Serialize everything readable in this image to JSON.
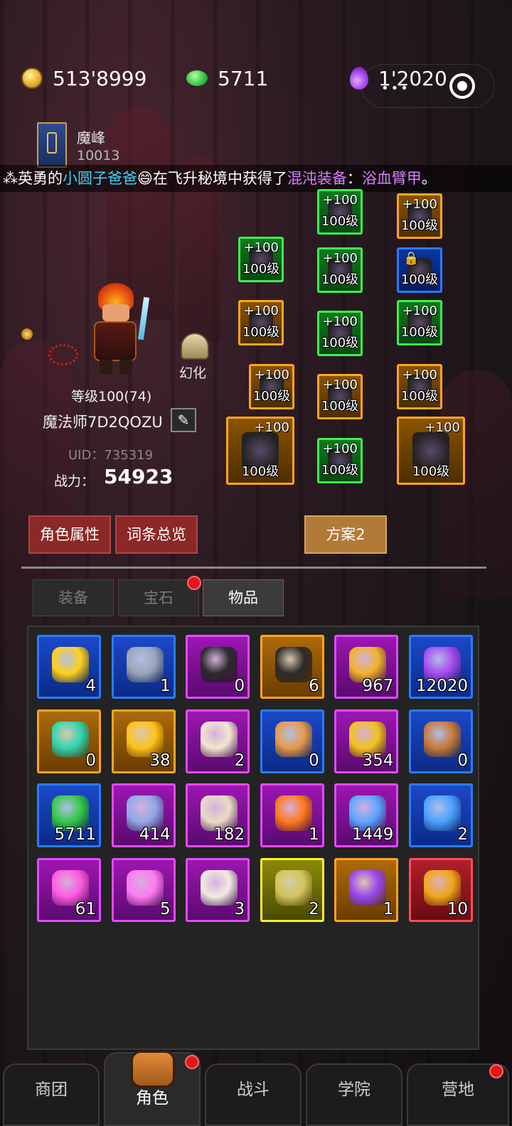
{
  "currency": {
    "gold": "513'8999",
    "emerald": "5711",
    "essence": "1'2020"
  },
  "guild": {
    "name": "魔峰",
    "id": "10013"
  },
  "banner": {
    "prefix": "英勇的",
    "player": "小圆子爸爸",
    "emoji": "😄",
    "middle": "在飞升秘境中获得了",
    "type": "混沌装备",
    "colon": "：",
    "item": "浴血臂甲",
    "end": "。"
  },
  "equipment": [
    {
      "plus": "+100",
      "level": "100级",
      "quality": "green",
      "icon": "wing-icon"
    },
    {
      "plus": "+100",
      "level": "100级",
      "quality": "orange",
      "icon": "necklace-icon"
    },
    {
      "plus": "+100",
      "level": "100级",
      "quality": "green",
      "icon": "purple-orb-icon"
    },
    {
      "plus": "+100",
      "level": "100级",
      "quality": "green",
      "icon": "armor-icon"
    },
    {
      "plus": "",
      "level": "100级",
      "quality": "blue",
      "icon": "cloak-icon",
      "locked": true
    },
    {
      "plus": "+100",
      "level": "100级",
      "quality": "orange",
      "icon": "gloves-icon"
    },
    {
      "plus": "+100",
      "level": "100级",
      "quality": "green",
      "icon": "belt-icon"
    },
    {
      "plus": "+100",
      "level": "100级",
      "quality": "green",
      "icon": "gauntlet-icon"
    },
    {
      "plus": "+100",
      "level": "100级",
      "quality": "orange",
      "icon": "bracer-icon"
    },
    {
      "plus": "+100",
      "level": "100级",
      "quality": "orange",
      "icon": "leggings-icon"
    },
    {
      "plus": "+100",
      "level": "100级",
      "quality": "orange",
      "icon": "ring-icon"
    },
    {
      "plus": "+100",
      "level": "100级",
      "quality": "orange",
      "icon": "dagger-icon"
    },
    {
      "plus": "+100",
      "level": "100级",
      "quality": "green",
      "icon": "boots-icon"
    },
    {
      "plus": "+100",
      "level": "100级",
      "quality": "orange",
      "icon": "shield-icon"
    }
  ],
  "character": {
    "transform_label": "幻化",
    "level": "等级100(74)",
    "name": "魔法师7D2QOZU",
    "uid": "UID：735319",
    "power_label": "战力：",
    "power": "54923"
  },
  "buttons": {
    "attributes": "角色属性",
    "entries": "词条总览",
    "plan": "方案2"
  },
  "tabs": [
    "装备",
    "宝石",
    "物品"
  ],
  "items": [
    {
      "count": "4",
      "rarity": "blue",
      "icon": "ticket-icon",
      "color": "#ffd11a"
    },
    {
      "count": "1",
      "rarity": "blue",
      "icon": "ore-icon",
      "color": "#9aa6b8"
    },
    {
      "count": "0",
      "rarity": "purple",
      "icon": "purple-rune-stone-icon",
      "color": "#2a2a2a"
    },
    {
      "count": "6",
      "rarity": "orange",
      "icon": "orange-rune-stone-icon",
      "color": "#2a2a2a"
    },
    {
      "count": "967",
      "rarity": "purple",
      "icon": "crown-icon",
      "color": "#f0b32a"
    },
    {
      "count": "12020",
      "rarity": "blue",
      "icon": "essence-drop-icon",
      "color": "#a84bf2"
    },
    {
      "count": "0",
      "rarity": "orange",
      "icon": "swirl-portal-icon",
      "color": "#2fd6b0"
    },
    {
      "count": "38",
      "rarity": "orange",
      "icon": "heart-icon",
      "color": "#ffc21a"
    },
    {
      "count": "2",
      "rarity": "purple",
      "icon": "scroll-icon",
      "color": "#f2e6d0"
    },
    {
      "count": "0",
      "rarity": "blue",
      "icon": "bread-icon",
      "color": "#e89a4a"
    },
    {
      "count": "354",
      "rarity": "purple",
      "icon": "gold-coin-icon",
      "color": "#f2c21a"
    },
    {
      "count": "0",
      "rarity": "blue",
      "icon": "wood-logs-icon",
      "color": "#c77a3a"
    },
    {
      "count": "5711",
      "rarity": "blue",
      "icon": "emerald-icon",
      "color": "#34c945"
    },
    {
      "count": "414",
      "rarity": "purple",
      "icon": "spiral-stone-icon",
      "color": "#8fa8e8"
    },
    {
      "count": "182",
      "rarity": "purple",
      "icon": "map-scroll-icon",
      "color": "#e8dcc2"
    },
    {
      "count": "1",
      "rarity": "purple",
      "icon": "fire-icon",
      "color": "#ff7a1a"
    },
    {
      "count": "1449",
      "rarity": "purple",
      "icon": "blue-crystal-icon",
      "color": "#5aa6ff"
    },
    {
      "count": "2",
      "rarity": "blue",
      "icon": "blue-key-icon",
      "color": "#4aa0ff"
    },
    {
      "count": "61",
      "rarity": "purple",
      "icon": "pink-key-icon",
      "color": "#ff5ae0"
    },
    {
      "count": "5",
      "rarity": "purple",
      "icon": "sparkle-icon",
      "color": "#ff7af0"
    },
    {
      "count": "3",
      "rarity": "purple",
      "icon": "white-egg-icon",
      "color": "#f0ece0"
    },
    {
      "count": "2",
      "rarity": "yellow",
      "icon": "spotted-egg-icon",
      "color": "#d4c35a"
    },
    {
      "count": "1",
      "rarity": "orange",
      "icon": "rainbow-egg-icon",
      "color": "#9a46f0"
    },
    {
      "count": "10",
      "rarity": "red",
      "icon": "rabbit-coin-icon",
      "color": "#f2a51a"
    }
  ],
  "nav": [
    "商团",
    "角色",
    "战斗",
    "学院",
    "营地"
  ]
}
